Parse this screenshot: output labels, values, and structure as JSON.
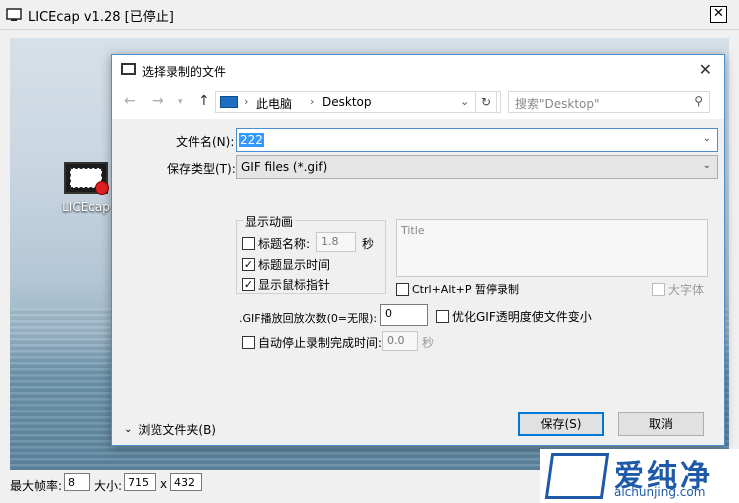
{
  "app": {
    "title": "LICEcap v1.28 [已停止]"
  },
  "desktop": {
    "icon_label": "LICEcap"
  },
  "bottom_bar": {
    "fps_label": "最大帧率:",
    "fps_value": "8",
    "size_label": "大小:",
    "width": "715",
    "x_sep": "x",
    "height": "432"
  },
  "dialog": {
    "title": "选择录制的文件",
    "breadcrumb": [
      "此电脑",
      "Desktop"
    ],
    "search_placeholder": "搜索\"Desktop\"",
    "filename_label": "文件名(N):",
    "filename_value": "222",
    "filetype_label": "保存类型(T):",
    "filetype_value": "GIF files (*.gif)",
    "anim_group": "显示动画",
    "cb_title_name": "标题名称:",
    "title_secs": "1.8",
    "secs_unit": "秒",
    "cb_title_time": "标题显示时间",
    "cb_mouse": "显示鼠标指针",
    "title_placeholder": "Title",
    "cb_pause": "Ctrl+Alt+P 暂停录制",
    "cb_bigfont": "大字体",
    "loop_label": ".GIF播放回放次数(0=无限):",
    "loop_value": "0",
    "cb_optimize": "优化GIF透明度使文件变小",
    "cb_autostop": "自动停止录制完成时间:",
    "autostop_value": "0.0",
    "autostop_unit": "秒",
    "browse_label": "浏览文件夹(B)",
    "save_label": "保存(S)",
    "cancel_label": "取消"
  },
  "watermark": {
    "cn": "爱纯净",
    "en": "aichunjing.com"
  },
  "colors": {
    "accent": "#0078d7",
    "selection": "#3399ff",
    "brand": "#1e5aa8"
  }
}
